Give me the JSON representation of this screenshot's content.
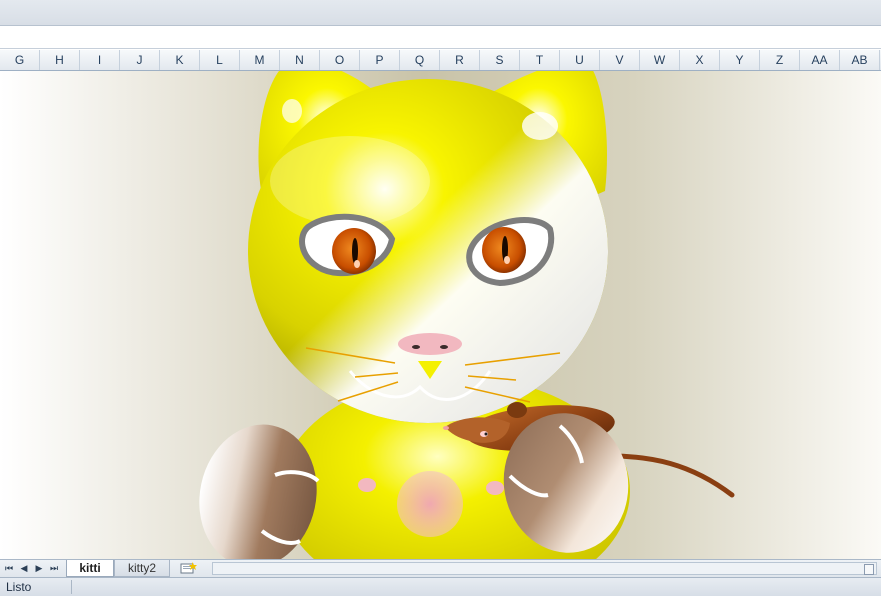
{
  "columns": [
    "G",
    "H",
    "I",
    "J",
    "K",
    "L",
    "M",
    "N",
    "O",
    "P",
    "Q",
    "R",
    "S",
    "T",
    "U",
    "V",
    "W",
    "X",
    "Y",
    "Z",
    "AA",
    "AB"
  ],
  "sheet_tabs": {
    "active": "kitti",
    "other": "kitty2"
  },
  "nav_buttons": {
    "first": "⏮",
    "prev": "◀",
    "next": "▶",
    "last": "⏭"
  },
  "new_sheet_icon": "insert-sheet-icon",
  "status": {
    "text": "Listo"
  },
  "colors": {
    "cat_body": "#f2ee00",
    "cat_white": "#ffffff",
    "eye_iris": "#d35a00",
    "nose": "#f2b8c0",
    "mouse": "#8a3f12",
    "paw": "#a57e63"
  }
}
